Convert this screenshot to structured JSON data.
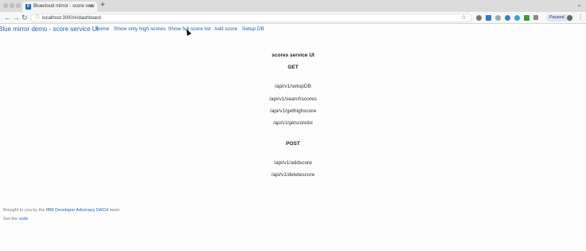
{
  "browser": {
    "tab_title": "Bluecloud mirror - score serv",
    "tab_favicon": "page-favicon",
    "url": "localhost:3000/#/dashboard",
    "paused_label": "Paused",
    "icons": [
      "back-arrow-icon",
      "forward-arrow-icon",
      "reload-icon",
      "lock-icon",
      "star-icon",
      "extension-icons",
      "profile-avatar-icon",
      "menu-kebab-icon"
    ]
  },
  "nav": {
    "brand": "Blue mirror demo - score service UI",
    "links": [
      "home",
      "Show only high scores",
      "Show full score list",
      "Add score",
      "Setup DB"
    ]
  },
  "main": {
    "title": "scores service UI",
    "get_heading": "GET",
    "get_endpoints": [
      "/api/v1/setupDB",
      "/api/v1/searchscores",
      "/api/v1/gethighscore",
      "/api/v1/getscorelist"
    ],
    "post_heading": "POST",
    "post_endpoints": [
      "/api/v1/addscore",
      "/api/v1/deletescore"
    ]
  },
  "footer": {
    "brought_prefix": "Brought to you by the",
    "team_link": "IBM Developer Advocacy DACH",
    "brought_suffix": "team",
    "code_prefix": "Get the",
    "code_link": "code"
  },
  "colors": {
    "link": "#1e5fbf",
    "text": "#222222",
    "muted": "#777777"
  }
}
